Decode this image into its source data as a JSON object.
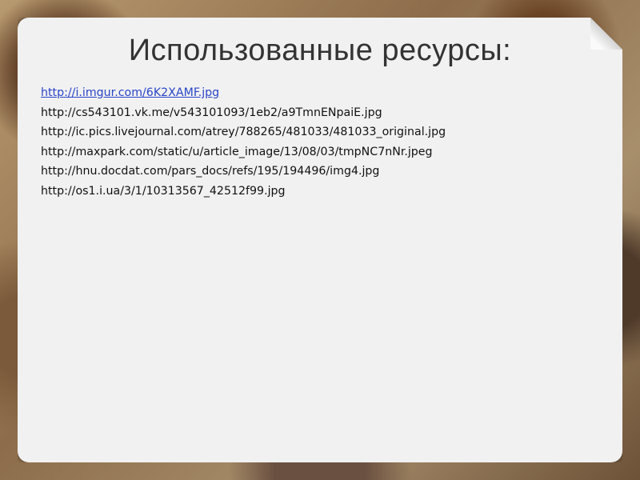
{
  "slide": {
    "title": "Использованные ресурсы:",
    "links": [
      "http://i.imgur.com/6K2XAMF.jpg",
      "http://cs543101.vk.me/v543101093/1eb2/a9TmnENpaiE.jpg",
      "http://ic.pics.livejournal.com/atrey/788265/481033/481033_original.jpg",
      "http://maxpark.com/static/u/article_image/13/08/03/tmpNC7nNr.jpeg",
      "http://hnu.docdat.com/pars_docs/refs/195/194496/img4.jpg",
      "http://os1.i.ua/3/1/10313567_42512f99.jpg"
    ]
  }
}
